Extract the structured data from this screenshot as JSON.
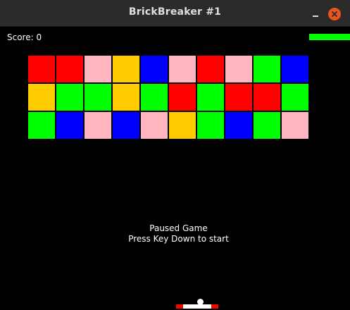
{
  "window": {
    "title": "BrickBreaker #1"
  },
  "hud": {
    "score_text": "Score: 0",
    "lives_color": "#00ff00"
  },
  "palette": {
    "red": "#ff0000",
    "pink": "#ffb6c1",
    "yellow": "#ffcc00",
    "blue": "#0000ff",
    "green": "#00ff00"
  },
  "bricks": [
    [
      "red",
      "red",
      "pink",
      "yellow",
      "blue",
      "pink",
      "red",
      "pink",
      "green",
      "blue"
    ],
    [
      "yellow",
      "green",
      "green",
      "yellow",
      "green",
      "red",
      "green",
      "red",
      "red",
      "green"
    ],
    [
      "green",
      "blue",
      "pink",
      "blue",
      "pink",
      "yellow",
      "green",
      "blue",
      "green",
      "pink"
    ]
  ],
  "message": {
    "line1": "Paused Game",
    "line2": "Press Key Down to start"
  },
  "paddle": {
    "colors": [
      "#ff0000",
      "#ffffff",
      "#ff0000"
    ]
  },
  "ball": {
    "color": "#ffffff"
  }
}
